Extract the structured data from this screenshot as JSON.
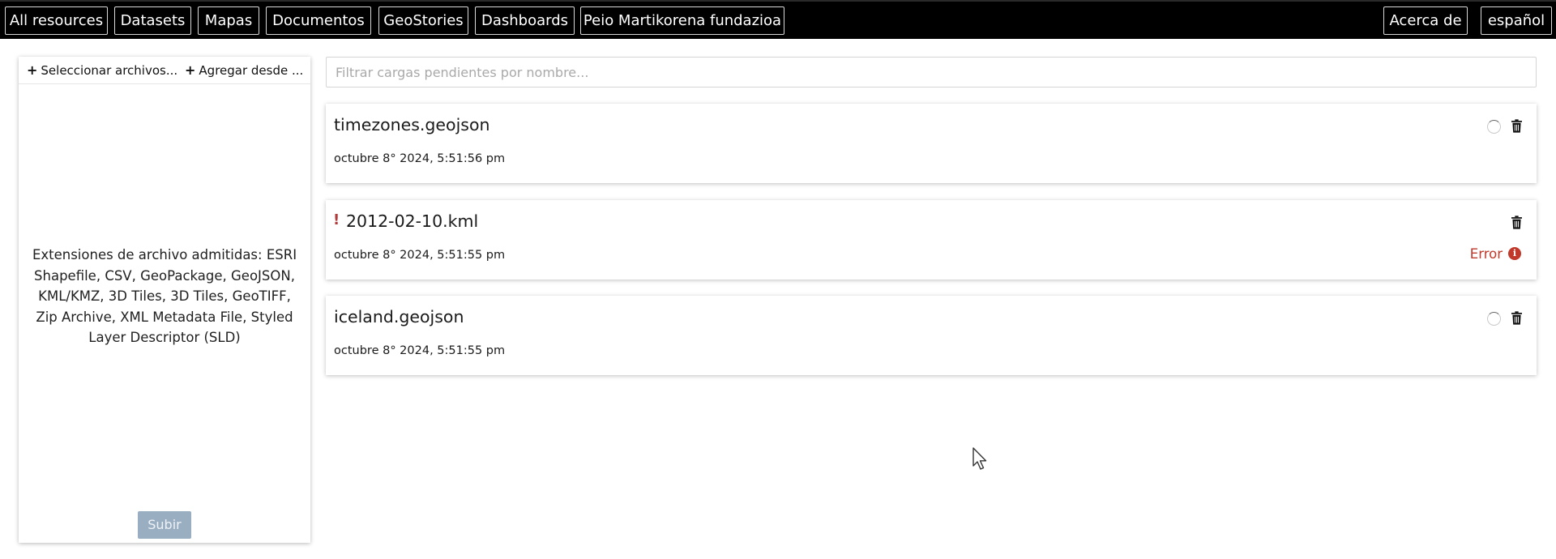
{
  "nav": {
    "left_items": [
      "All resources",
      "Datasets",
      "Mapas",
      "Documentos",
      "GeoStories",
      "Dashboards",
      "Peio Martikorena fundazioa"
    ],
    "about": "Acerca de",
    "language": "español"
  },
  "upload": {
    "select_files": "Seleccionar archivos...",
    "add_from": "Agregar desde ...",
    "supported_text": "Extensiones de archivo admitidas: ESRI Shapefile, CSV, GeoPackage, GeoJSON, KML/KMZ, 3D Tiles, 3D Tiles, GeoTIFF, Zip Archive, XML Metadata File, Styled Layer Descriptor (SLD)",
    "submit": "Subir"
  },
  "filter": {
    "placeholder": "Filtrar cargas pendientes por nombre..."
  },
  "cards": [
    {
      "name": "timezones.geojson",
      "date": "octubre 8° 2024, 5:51:56 pm",
      "status": "loading"
    },
    {
      "name": "2012-02-10.kml",
      "date": "octubre 8° 2024, 5:51:55 pm",
      "status": "error",
      "error_label": "Error"
    },
    {
      "name": "iceland.geojson",
      "date": "octubre 8° 2024, 5:51:55 pm",
      "status": "loading"
    }
  ],
  "colors": {
    "topbar": "#000000",
    "error": "#c0392b",
    "warning": "#b23a3a",
    "submit_disabled": "#9aaec2"
  }
}
